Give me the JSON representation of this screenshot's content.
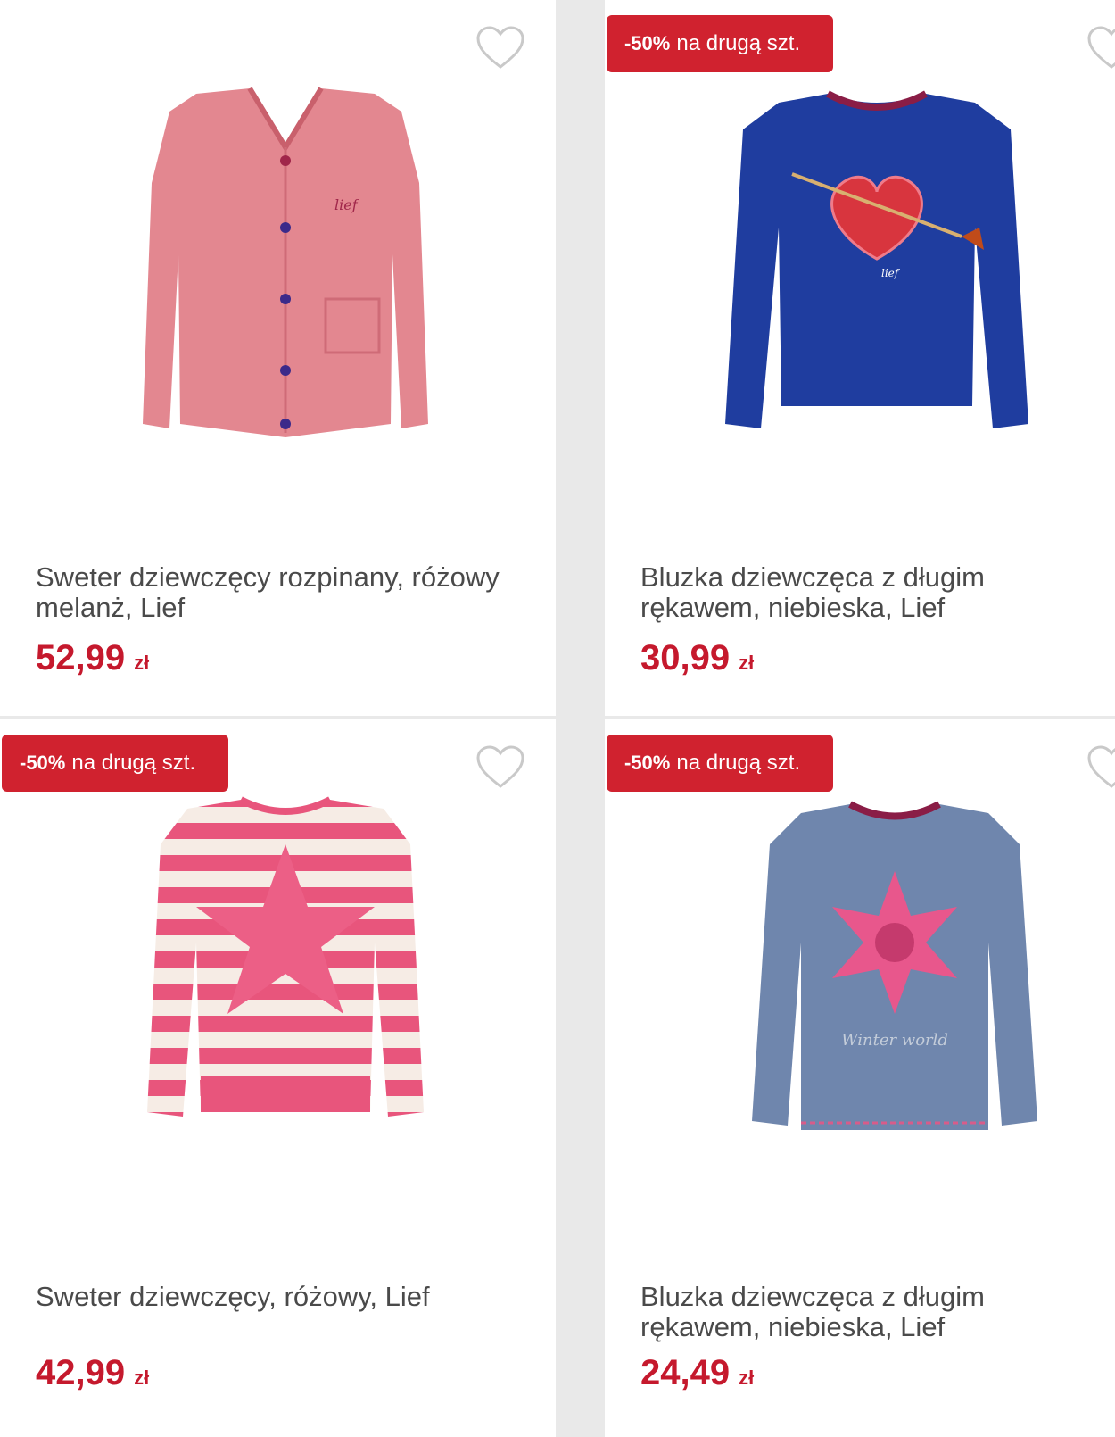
{
  "colors": {
    "accent": "#d0222f",
    "price": "#c5192d",
    "text": "#4a4a4a"
  },
  "products": [
    {
      "title": "Sweter dziewczęcy rozpinany, różowy melanż, Lief",
      "price": "52,99",
      "currency": "zł",
      "badge_pct": "",
      "badge_text": "",
      "image": "pink-knit-cardigan"
    },
    {
      "title": "Bluzka dziewczęca z długim rękawem, niebieska, Lief",
      "price": "30,99",
      "currency": "zł",
      "badge_pct": "-50%",
      "badge_text": "na drugą szt.",
      "image": "blue-heart-sweatshirt"
    },
    {
      "title": "Sweter dziewczęcy, różowy, Lief",
      "price": "42,99",
      "currency": "zł",
      "badge_pct": "-50%",
      "badge_text": "na drugą szt.",
      "image": "striped-star-sweater"
    },
    {
      "title": "Bluzka dziewczęca z długim rękawem, niebieska, Lief",
      "price": "24,49",
      "currency": "zł",
      "badge_pct": "-50%",
      "badge_text": "na drugą szt.",
      "image": "grey-snowflake-top",
      "print_text": "Winter world"
    }
  ]
}
